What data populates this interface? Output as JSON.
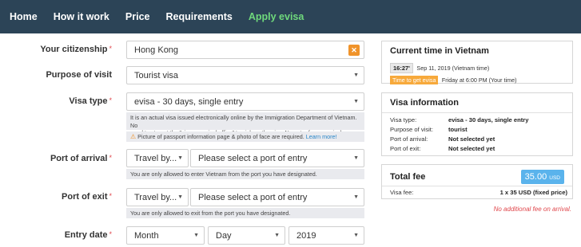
{
  "nav": {
    "items": [
      "Home",
      "How it work",
      "Price",
      "Requirements",
      "Apply evisa"
    ]
  },
  "form": {
    "citizenship": {
      "label": "Your citizenship",
      "required": "*",
      "value": "Hong Kong",
      "clear": "✕"
    },
    "purpose": {
      "label": "Purpose of visit",
      "value": "Tourist visa"
    },
    "visa_type": {
      "label": "Visa type",
      "required": "*",
      "value": "evisa - 30 days, single entry",
      "note_line1": "It is an actual visa issued electronically online by the Immigration Department of Vietnam. No",
      "note_line2": "need to stop at the \"visa on arrival office\" to pick up the visa. No extra fee on arrival.",
      "warn_text": "Picture of passport information page & photo of face are required.",
      "warn_link": "Learn more!"
    },
    "port_arrival": {
      "label": "Port of arrival",
      "required": "*",
      "travel_by": "Travel by...",
      "port_placeholder": "Please select a port of entry",
      "note": "You are only allowed to enter Vietnam from the port you have designated."
    },
    "port_exit": {
      "label": "Port of exit",
      "required": "*",
      "travel_by": "Travel by...",
      "port_placeholder": "Please select a port of entry",
      "note": "You are only allowed to exit from the port you have designated."
    },
    "entry_date": {
      "label": "Entry date",
      "required": "*",
      "month": "Month",
      "day": "Day",
      "year": "2019"
    }
  },
  "current_time": {
    "title": "Current time in Vietnam",
    "time": "16:27'",
    "date": "Sep 11, 2019 (Vietnam time)",
    "tag": "Time to get evisa",
    "tag_text": "Friday at 6:00 PM (Your time)"
  },
  "visa_info": {
    "title": "Visa information",
    "rows": [
      {
        "k": "Visa type:",
        "v": "evisa - 30 days, single entry"
      },
      {
        "k": "Purpose of visit:",
        "v": "tourist"
      },
      {
        "k": "Port of arrival:",
        "v": "Not selected yet"
      },
      {
        "k": "Port of exit:",
        "v": "Not selected yet"
      }
    ]
  },
  "fee": {
    "title": "Total fee",
    "amount": "35.00",
    "currency": "USD",
    "line_label": "Visa fee:",
    "line_value": "1 x 35 USD (fixed price)",
    "note": "No additional fee on arrival."
  }
}
